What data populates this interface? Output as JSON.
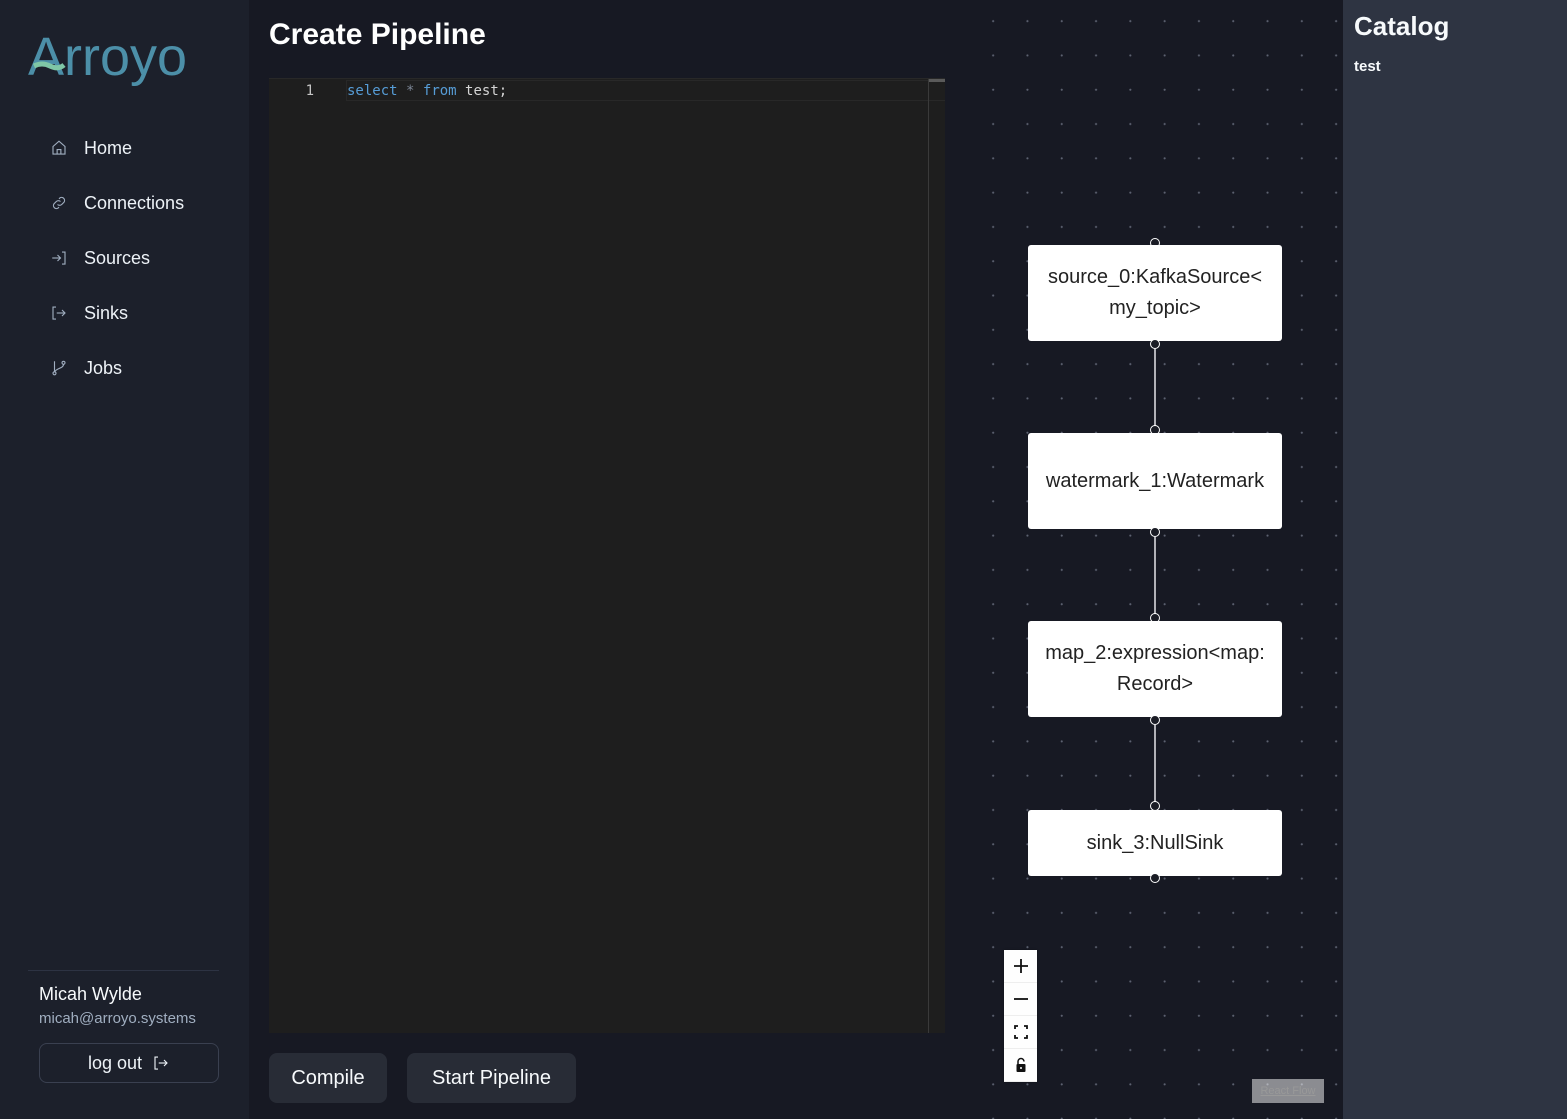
{
  "brand": {
    "name": "Arroyo",
    "primary_color": "#4c8fa8",
    "accent_color": "#7fc7a6"
  },
  "sidebar": {
    "items": [
      {
        "label": "Home",
        "icon": "home-icon"
      },
      {
        "label": "Connections",
        "icon": "link-icon"
      },
      {
        "label": "Sources",
        "icon": "sign-in-icon"
      },
      {
        "label": "Sinks",
        "icon": "sign-out-icon"
      },
      {
        "label": "Jobs",
        "icon": "git-branch-icon"
      }
    ],
    "user": {
      "name": "Micah Wylde",
      "email": "micah@arroyo.systems"
    },
    "logout_label": "log out"
  },
  "main": {
    "title": "Create Pipeline",
    "editor": {
      "line_number": "1",
      "tokens": {
        "kw1": "select",
        "op": "*",
        "kw2": "from",
        "id": "test;"
      }
    },
    "buttons": {
      "compile": "Compile",
      "start": "Start Pipeline"
    }
  },
  "flow": {
    "nodes": [
      {
        "label": "source_0:KafkaSource<my_topic>"
      },
      {
        "label": "watermark_1:Watermark"
      },
      {
        "label": "map_2:expression<map:Record>"
      },
      {
        "label": "sink_3:NullSink"
      }
    ],
    "controls": [
      "zoom-in",
      "zoom-out",
      "fit-view",
      "toggle-interactivity"
    ],
    "attribution": "React Flow"
  },
  "catalog": {
    "title": "Catalog",
    "tables": [
      "test"
    ]
  }
}
